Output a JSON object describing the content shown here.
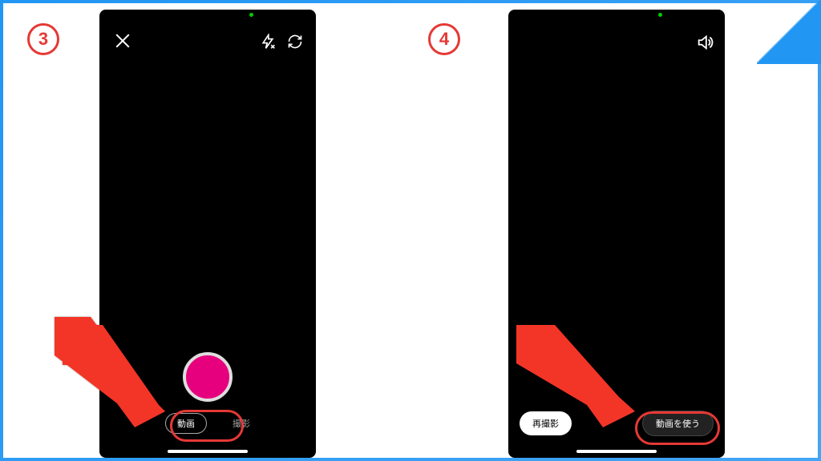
{
  "steps": {
    "three": "3",
    "four": "4"
  },
  "phone3": {
    "mode_video": "動画",
    "mode_capture": "撮影"
  },
  "phone4": {
    "retake": "再撮影",
    "use_video": "動画を使う"
  },
  "colors": {
    "accent_red": "#E53935",
    "record_pink": "#E6007E",
    "bg_blue": "#2196F3"
  }
}
